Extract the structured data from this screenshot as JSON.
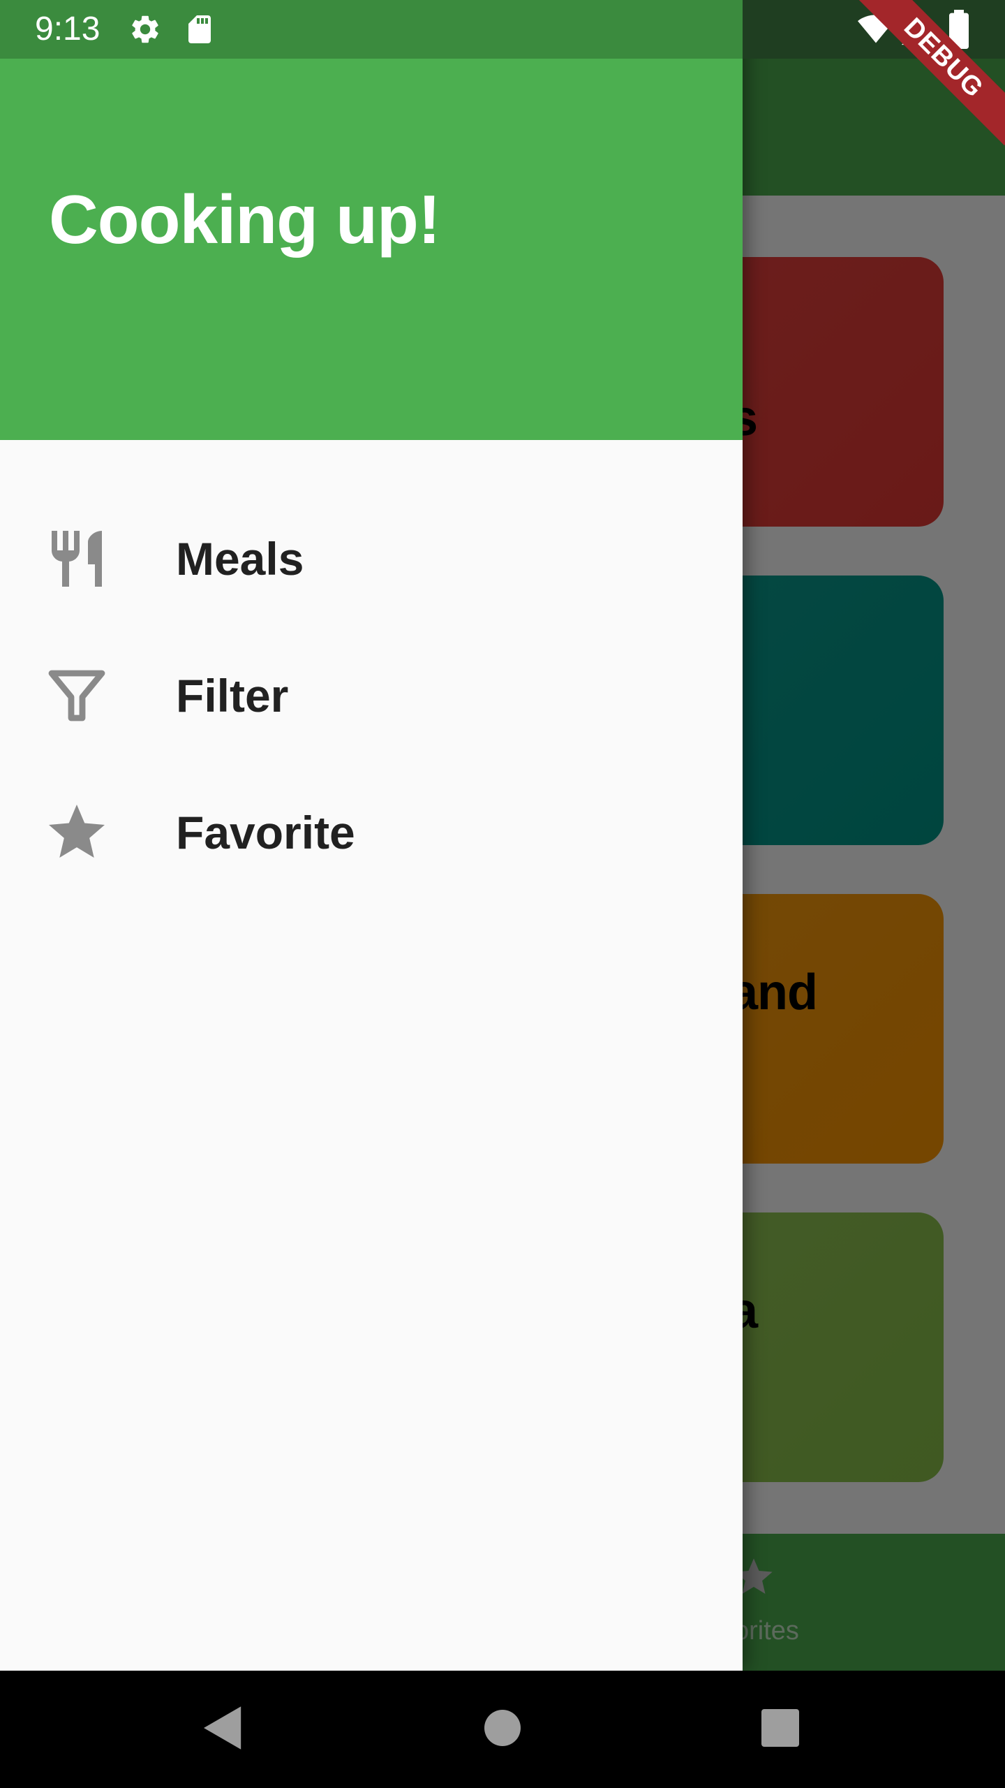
{
  "status_bar": {
    "time": "9:13",
    "icons": [
      "settings-icon",
      "sd-card-icon",
      "wifi-icon",
      "cell-signal-icon",
      "battery-icon"
    ]
  },
  "debug_banner": {
    "label": "DEBUG"
  },
  "drawer": {
    "title": "Cooking up!",
    "items": [
      {
        "label": "Meals",
        "icon": "restaurant-icon"
      },
      {
        "label": "Filter",
        "icon": "filter-icon"
      },
      {
        "label": "Favorite",
        "icon": "star-icon"
      }
    ]
  },
  "background": {
    "categories": [
      {
        "visible_text": "s",
        "color": "#e53935"
      },
      {
        "visible_text": "",
        "color": "#009688"
      },
      {
        "visible_text": "and",
        "color": "#ff9800"
      },
      {
        "visible_text": "a",
        "color": "#8bc34a"
      }
    ],
    "bottom_nav": {
      "favorites_partial_label": "orites"
    }
  },
  "colors": {
    "primary": "#4caf50",
    "drawer_background": "#fafafa",
    "drawer_icon": "#8a8a8a",
    "debug_banner": "#a3262a"
  }
}
